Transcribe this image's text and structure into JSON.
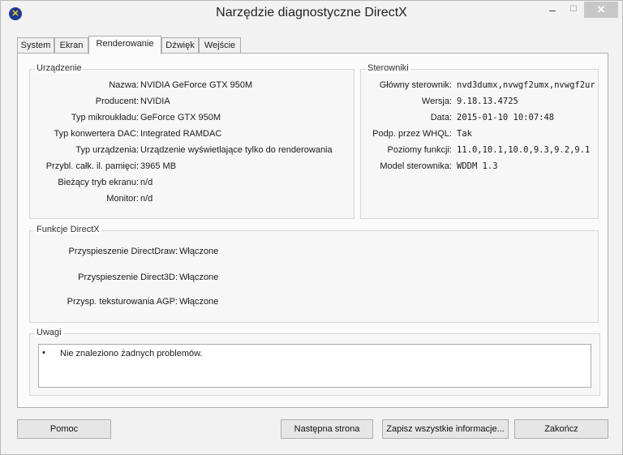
{
  "window": {
    "title": "Narzędzie diagnostyczne DirectX",
    "controls": {
      "minimize": "–",
      "maximize": "☐",
      "close": "✕"
    }
  },
  "tabs": [
    {
      "label": "System"
    },
    {
      "label": "Ekran"
    },
    {
      "label": "Renderowanie",
      "active": true
    },
    {
      "label": "Dźwięk"
    },
    {
      "label": "Wejście"
    }
  ],
  "device": {
    "legend": "Urządzenie",
    "rows": [
      {
        "label": "Nazwa:",
        "value": "NVIDIA GeForce GTX 950M"
      },
      {
        "label": "Producent:",
        "value": "NVIDIA"
      },
      {
        "label": "Typ mikroukładu:",
        "value": "GeForce GTX 950M"
      },
      {
        "label": "Typ konwertera DAC:",
        "value": "Integrated RAMDAC"
      },
      {
        "label": "Typ urządzenia:",
        "value": "Urządzenie wyświetlające tylko do renderowania"
      },
      {
        "label": "Przybl. całk. il. pamięci:",
        "value": "3965 MB"
      },
      {
        "label": "Bieżący tryb ekranu:",
        "value": "n/d"
      },
      {
        "label": "Monitor:",
        "value": "n/d"
      }
    ]
  },
  "drivers": {
    "legend": "Sterowniki",
    "rows": [
      {
        "label": "Główny sterownik:",
        "value": "nvd3dumx,nvwgf2umx,nvwgf2ur"
      },
      {
        "label": "Wersja:",
        "value": "9.18.13.4725"
      },
      {
        "label": "Data:",
        "value": "2015-01-10 10:07:48"
      },
      {
        "label": "Podp. przez WHQL:",
        "value": "Tak"
      },
      {
        "label": "Poziomy funkcji:",
        "value": "11.0,10.1,10.0,9.3,9.2,9.1"
      },
      {
        "label": "Model sterownika:",
        "value": "WDDM 1.3"
      }
    ]
  },
  "directx": {
    "legend": "Funkcje DirectX",
    "rows": [
      {
        "label": "Przyspieszenie DirectDraw:",
        "value": "Włączone"
      },
      {
        "label": "Przyspieszenie Direct3D:",
        "value": "Włączone"
      },
      {
        "label": "Przysp. teksturowania AGP:",
        "value": "Włączone"
      }
    ]
  },
  "notes": {
    "legend": "Uwagi",
    "bullet": "•",
    "items": [
      "Nie znaleziono żadnych problemów."
    ]
  },
  "buttons": {
    "help": "Pomoc",
    "next_page": "Następna strona",
    "save_all": "Zapisz wszystkie informacje...",
    "exit": "Zakończ"
  }
}
